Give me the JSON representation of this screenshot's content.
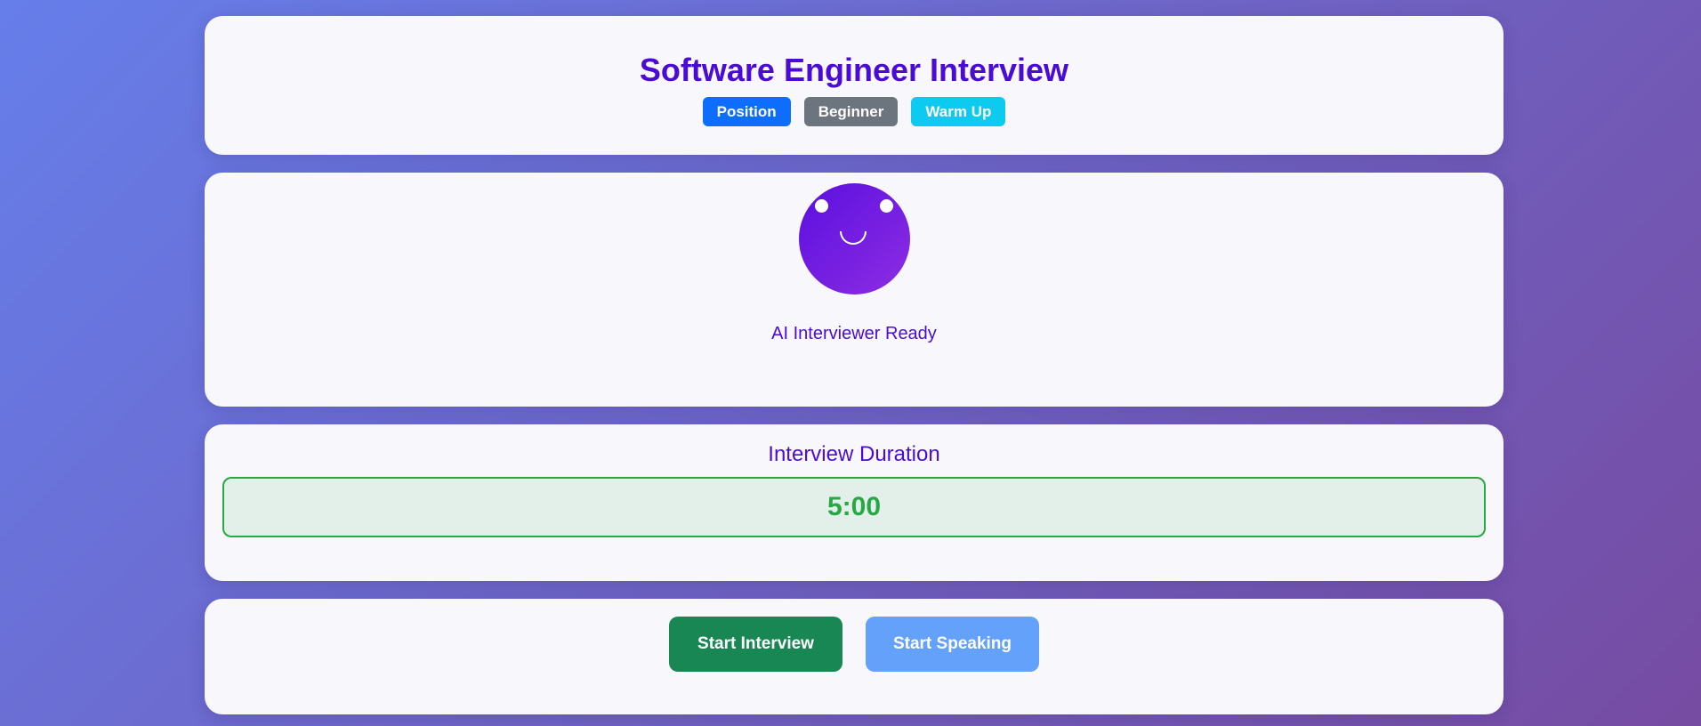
{
  "header": {
    "title": "Software Engineer Interview",
    "badges": [
      {
        "label": "Position",
        "color": "#0d6efd"
      },
      {
        "label": "Beginner",
        "color": "#6c757d"
      },
      {
        "label": "Warm Up",
        "color": "#0dcaf0"
      }
    ]
  },
  "avatar": {
    "icon": "smiley-face-icon",
    "gradient_start": "#5a0fe0",
    "gradient_end": "#8e2de2",
    "status": "AI Interviewer Ready"
  },
  "timer": {
    "heading": "Interview Duration",
    "value": "5:00",
    "color": "#28a745"
  },
  "controls": {
    "start_interview_label": "Start Interview",
    "start_interview_color": "#198754",
    "start_speaking_label": "Start Speaking",
    "start_speaking_color": "#64a1fb"
  },
  "theme": {
    "accent": "#4b0bd6",
    "background_start": "#667eea",
    "background_end": "#764ba2"
  }
}
